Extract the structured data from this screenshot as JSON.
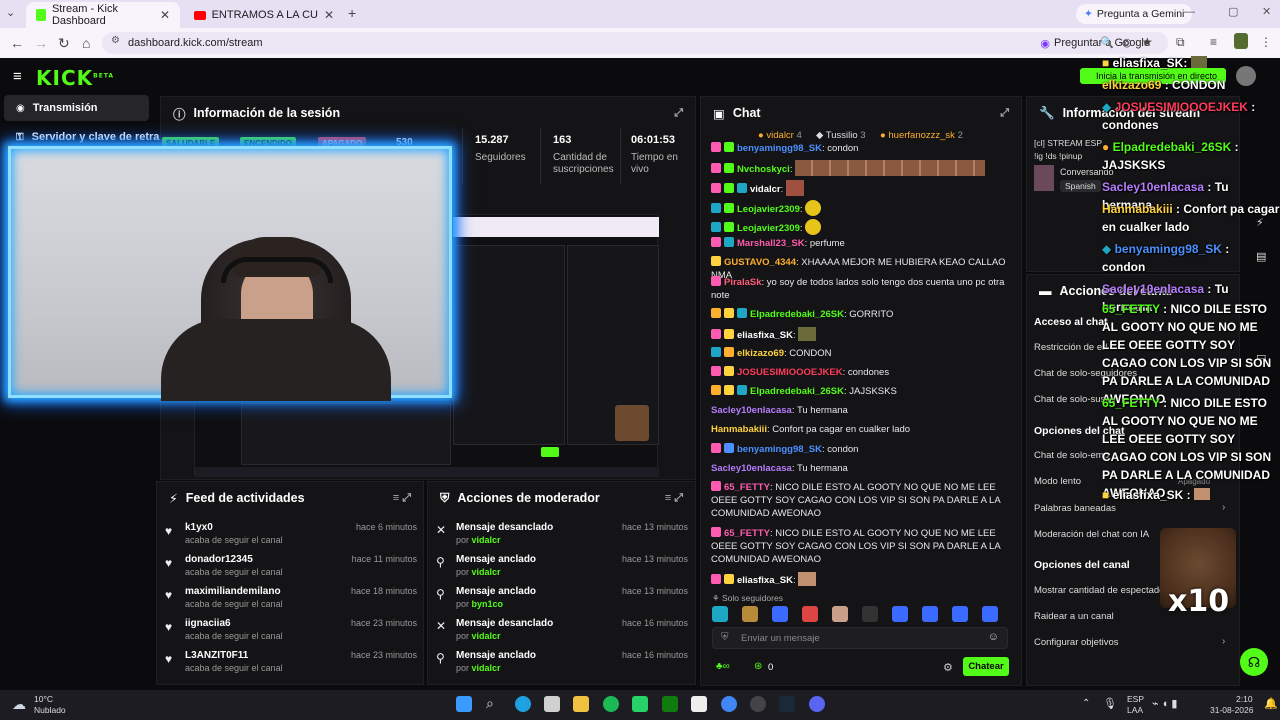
{
  "browser": {
    "tabs": [
      {
        "title": "Stream - Kick Dashboard",
        "active": true
      },
      {
        "title": "ENTRAMOS A LA CUEVA DE LA",
        "active": false
      }
    ],
    "gemini": "Pregunta a Gemini",
    "url": "dashboard.kick.com/stream",
    "google": "Preguntar a Google"
  },
  "kick": {
    "logo": "KICK",
    "beta": "BETA",
    "go_live": "Inicia la transmisión en directo",
    "sidebar": [
      {
        "label": "Transmisión"
      },
      {
        "label": "Servidor y clave de retran"
      }
    ]
  },
  "session": {
    "title": "Información de la sesión",
    "badges": [
      "SALUDABLE",
      "ENCENDIDO",
      "APAGADO"
    ],
    "stat_partial": "530",
    "stats": [
      {
        "value": "15.287",
        "label": "Seguidores"
      },
      {
        "value": "163",
        "label": "Cantidad de suscripciones"
      },
      {
        "value": "06:01:53",
        "label": "Tiempo en vivo"
      }
    ],
    "cam_overlay": "x10"
  },
  "feed": {
    "title": "Feed de actividades",
    "items": [
      {
        "name": "k1yx0",
        "sub": "acaba de seguir el canal",
        "time": "hace 6 minutos"
      },
      {
        "name": "donador12345",
        "sub": "acaba de seguir el canal",
        "time": "hace 11 minutos"
      },
      {
        "name": "maximiliandemilano",
        "sub": "acaba de seguir el canal",
        "time": "hace 18 minutos"
      },
      {
        "name": "iignaciia6",
        "sub": "acaba de seguir el canal",
        "time": "hace 23 minutos"
      },
      {
        "name": "L3ANZIT0F11",
        "sub": "acaba de seguir el canal",
        "time": "hace 23 minutos"
      }
    ]
  },
  "mod": {
    "title": "Acciones de moderador",
    "items": [
      {
        "action": "Mensaje desanclado",
        "by": "vidalcr",
        "time": "hace 13 minutos",
        "icon": "✕"
      },
      {
        "action": "Mensaje anclado",
        "by": "vidalcr",
        "time": "hace 13 minutos",
        "icon": "📌"
      },
      {
        "action": "Mensaje anclado",
        "by": "byn1co",
        "time": "hace 13 minutos",
        "icon": "📌"
      },
      {
        "action": "Mensaje desanclado",
        "by": "vidalcr",
        "time": "hace 16 minutos",
        "icon": "✕"
      },
      {
        "action": "Mensaje anclado",
        "by": "vidalcr",
        "time": "hace 16 minutos",
        "icon": "📌"
      }
    ],
    "by_prefix": "por"
  },
  "chat": {
    "title": "Chat",
    "top_gifters": [
      {
        "name": "vidalcr",
        "count": "4"
      },
      {
        "name": "Tussilio",
        "count": "3"
      },
      {
        "name": "huerfanozzz_sk",
        "count": "2"
      }
    ],
    "messages": [
      {
        "user": "benyamingg98_SK",
        "text": "condon",
        "color": "#4a90ff"
      },
      {
        "user": "Nvchoskyci",
        "text": "",
        "color": "#53fc18"
      },
      {
        "user": "vidalcr",
        "text": "",
        "color": "#ffffff"
      },
      {
        "user": "Leojavier2309",
        "text": "",
        "color": "#53fc18"
      },
      {
        "user": "Leojavier2309",
        "text": "",
        "color": "#53fc18"
      },
      {
        "user": "Marshall23_SK",
        "text": "perfume",
        "color": "#ff5bb0"
      },
      {
        "user": "GUSTAVO_4344",
        "text": "XHAAAA MEJOR ME HUBIERA KEAO CALLAO NMA",
        "color": "#ffae2e"
      },
      {
        "user": "PiralaSk",
        "text": "yo soy de todos lados solo tengo dos cuenta uno pc otra note",
        "color": "#ff5b7a"
      },
      {
        "user": "Elpadredebaki_26SK",
        "text": "GORRITO",
        "color": "#53fc18"
      },
      {
        "user": "eliasfixa_SK",
        "text": "",
        "color": "#ffffff"
      },
      {
        "user": "elkizazo69",
        "text": "CONDON",
        "color": "#ffd23f"
      },
      {
        "user": "JOSUESIMIOOOEJKEK",
        "text": "condones",
        "color": "#ff3b5c"
      },
      {
        "user": "Elpadredebaki_26SK",
        "text": "JAJSKSKS",
        "color": "#53fc18"
      },
      {
        "user": "Sacley10enlacasa",
        "text": "Tu hermana",
        "color": "#b67dff"
      },
      {
        "user": "Hanmabakiii",
        "text": "Confort pa cagar en cualker lado",
        "color": "#ffd23f"
      },
      {
        "user": "benyamingg98_SK",
        "text": "condon",
        "color": "#4a90ff"
      },
      {
        "user": "Sacley10enlacasa",
        "text": "Tu hermana",
        "color": "#b67dff"
      },
      {
        "user": "65_FETTY",
        "text": "NICO DILE ESTO AL GOOTY NO QUE NO ME LEE OEEE GOTTY SOY CAGAO CON LOS VIP SI SON PA DARLE A LA COMUNIDAD AWEONAO",
        "color": "#ff5bb0"
      },
      {
        "user": "65_FETTY",
        "text": "NICO DILE ESTO AL GOOTY NO QUE NO ME LEE OEEE GOTTY SOY CAGAO CON LOS VIP SI SON PA DARLE A LA COMUNIDAD AWEONAO",
        "color": "#ff5bb0"
      },
      {
        "user": "eliasfixa_SK",
        "text": "",
        "color": "#ffffff"
      }
    ],
    "followers_only": "Solo seguidores",
    "input_placeholder": "Enviar un mensaje",
    "counter": "0",
    "send": "Chatear"
  },
  "stream_info": {
    "title": "Información del stream",
    "stream_title": "[cl] STREAM ESP",
    "stream_commands": "!ig !ds !pinup",
    "category": "Conversando",
    "language": "Spanish"
  },
  "channel_actions": {
    "title": "Acciones del canal",
    "sections": [
      {
        "label": "Acceso al chat",
        "head": true
      },
      {
        "label": "Restricción de ed",
        "head": false
      },
      {
        "label": "Chat de solo-seguidores",
        "head": false
      },
      {
        "label": "Chat de solo-sus",
        "head": false
      },
      {
        "label": "Opciones del chat",
        "head": true
      },
      {
        "label": "Chat de solo-emo",
        "head": false
      },
      {
        "label": "Modo lento",
        "head": false
      },
      {
        "label": "Palabras baneadas",
        "head": false
      },
      {
        "label": "Moderación del chat con IA",
        "head": false
      },
      {
        "label": "Opciones del canal",
        "head": true
      },
      {
        "label": "Mostrar cantidad de espectador",
        "head": false
      },
      {
        "label": "Raidear a un canal",
        "head": false
      },
      {
        "label": "Configurar objetivos",
        "head": false
      }
    ],
    "slow_mode_state": "Apagado"
  },
  "overlay_chat": [
    {
      "user": "eliasfixa_SK",
      "text": "",
      "color": "#ffffff"
    },
    {
      "user": "elkizazo69",
      "text": "CONDON",
      "color": "#ffd23f"
    },
    {
      "user": "JOSUESIMIOOOEJKEK",
      "text": "condones",
      "color": "#ff3b5c"
    },
    {
      "user": "Elpadredebaki_26SK",
      "text": "JAJSKSKS",
      "color": "#53fc18"
    },
    {
      "user": "Sacley10enlacasa",
      "text": "Tu hermana",
      "color": "#b67dff"
    },
    {
      "user": "Hanmabakiii",
      "text": "Confort pa cagar en cualker lado",
      "color": "#ffd23f"
    },
    {
      "user": "benyamingg98_SK",
      "text": "condon",
      "color": "#4a90ff"
    },
    {
      "user": "Sacley10enlacasa",
      "text": "Tu hermana",
      "color": "#b67dff"
    },
    {
      "user": "65_FETTY",
      "text": "NICO DILE ESTO AL GOOTY NO QUE NO ME LEE OEEE GOTTY SOY CAGAO CON LOS VIP SI SON PA DARLE A LA COMUNIDAD AWEONAO",
      "color": "#53fc18"
    },
    {
      "user": "65_FETTY",
      "text": "NICO DILE ESTO AL GOOTY NO QUE NO ME LEE OEEE GOTTY SOY CAGAO CON LOS VIP SI SON PA DARLE A LA COMUNIDAD AWEONAO",
      "color": "#53fc18"
    },
    {
      "user": "eliasfixa_SK",
      "text": "",
      "color": "#ffffff"
    }
  ],
  "overlay_x10": "x10",
  "taskbar": {
    "weather_temp": "10°C",
    "weather_desc": "Nublado",
    "lang_top": "ESP",
    "lang_bottom": "LAA",
    "time": "2:10",
    "date": "31-08-2026"
  },
  "colors": {
    "kick_green": "#53fc18",
    "panel": "#141416",
    "bg": "#0b0b0d"
  }
}
